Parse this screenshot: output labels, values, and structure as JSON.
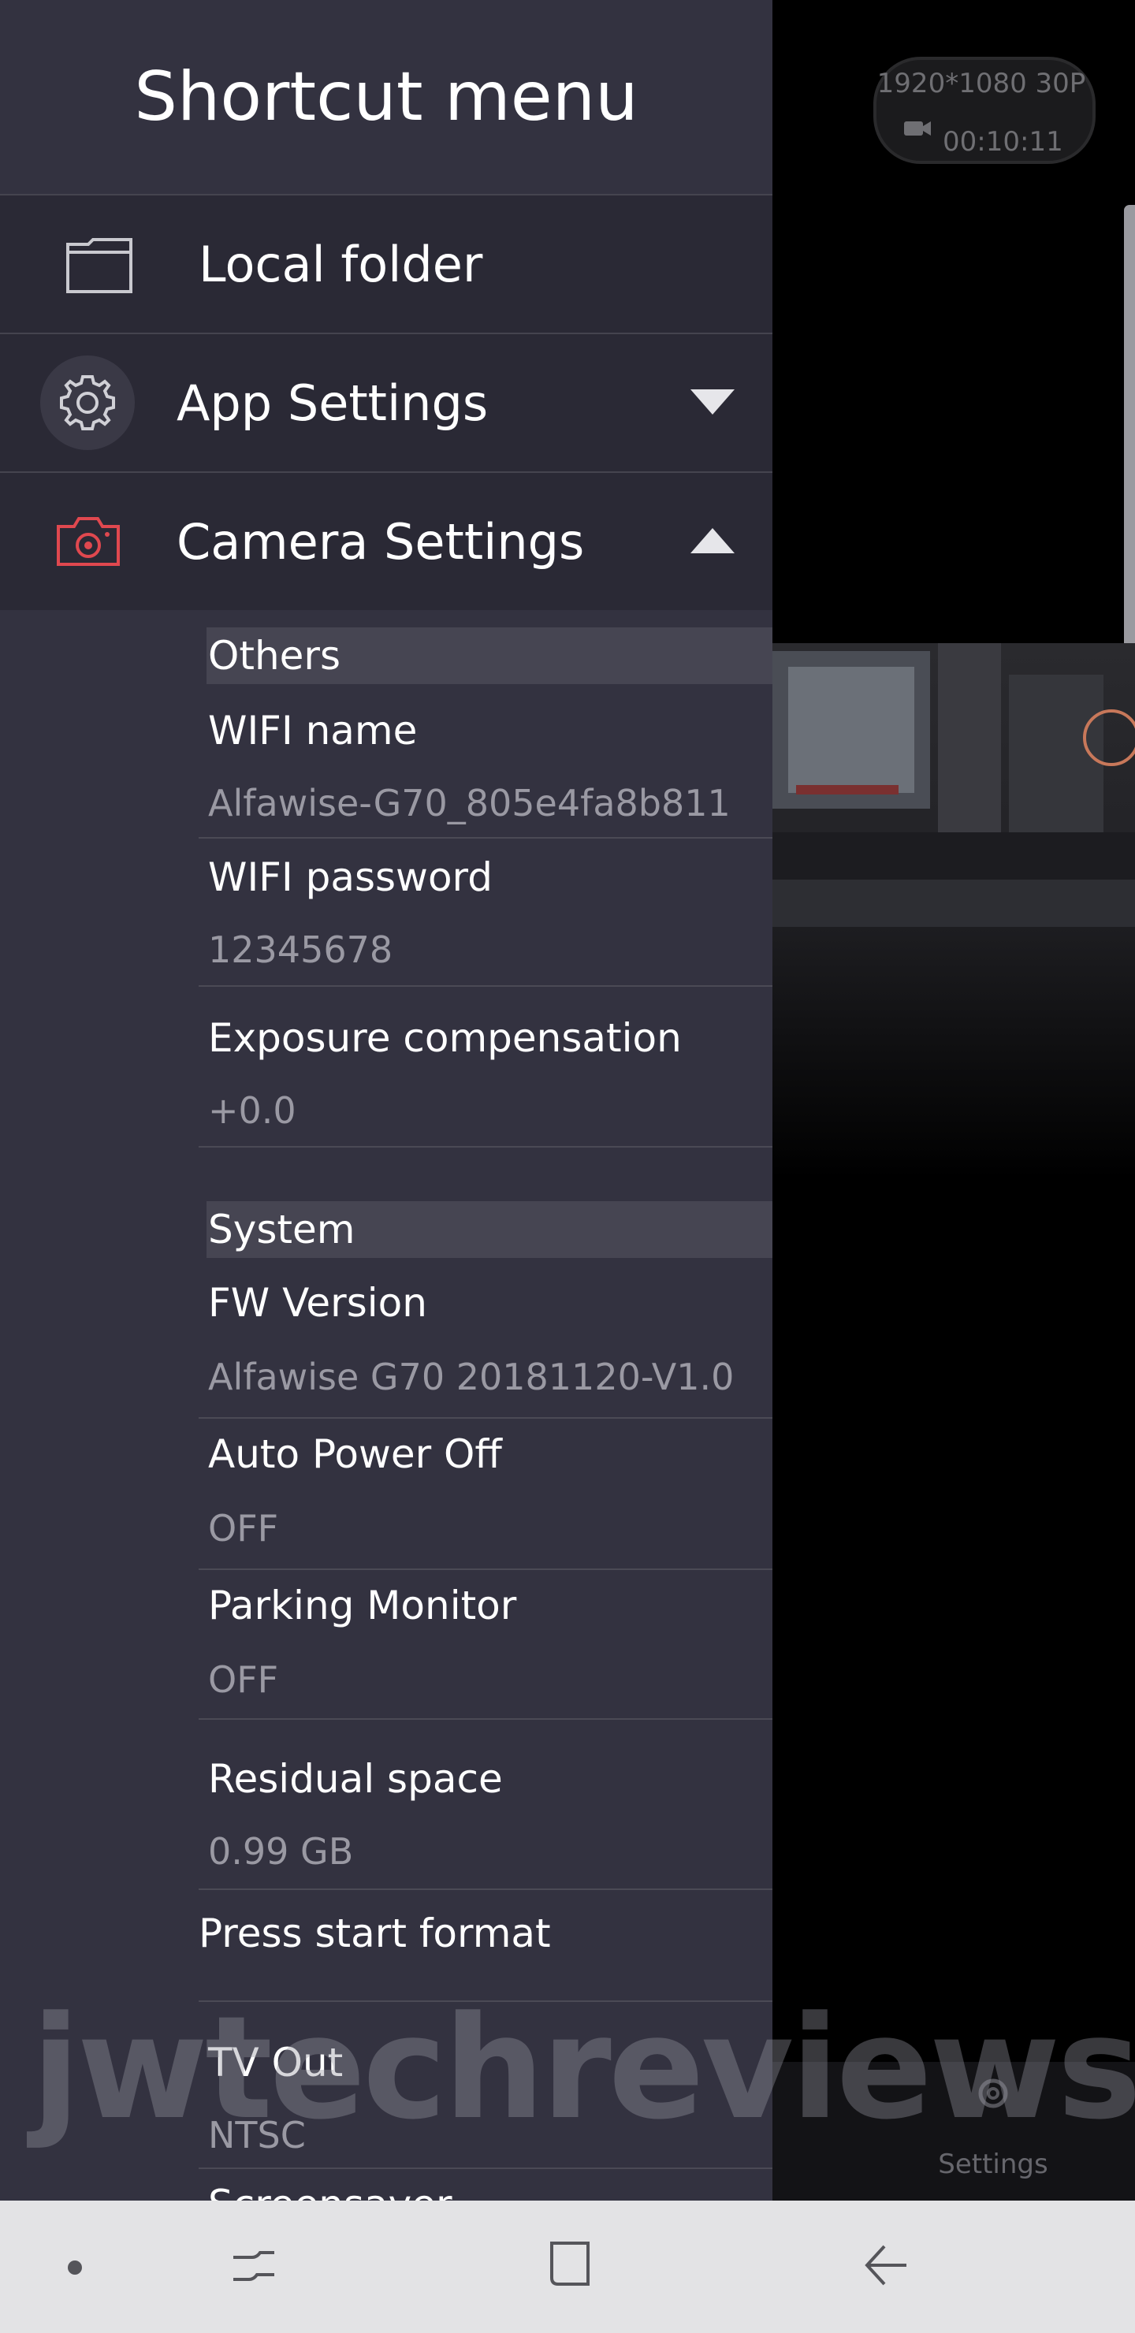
{
  "preview": {
    "resolution": "1920*1080 30P",
    "rec_time": "00:10:11",
    "settings_tab_label": "Settings"
  },
  "drawer": {
    "title": "Shortcut menu",
    "menu": [
      {
        "label": "Local folder",
        "icon": "folder-icon"
      },
      {
        "label": "App Settings",
        "icon": "gear-icon",
        "expanded": false
      },
      {
        "label": "Camera Settings",
        "icon": "camera-icon",
        "expanded": true
      }
    ],
    "sections": {
      "others": "Others",
      "system": "System"
    },
    "items": {
      "wifi_name": {
        "title": "WIFI name",
        "value": "Alfawise-G70_805e4fa8b811"
      },
      "wifi_password": {
        "title": "WIFI password",
        "value": "12345678"
      },
      "exposure": {
        "title": "Exposure compensation",
        "value": "+0.0"
      },
      "fw_version": {
        "title": "FW Version",
        "value": "Alfawise G70 20181120-V1.0"
      },
      "auto_power_off": {
        "title": "Auto Power Off",
        "value": "OFF"
      },
      "parking_monitor": {
        "title": "Parking Monitor",
        "value": "OFF"
      },
      "residual_space": {
        "title": "Residual space",
        "value": "0.99 GB"
      },
      "press_start_format": {
        "title": "Press start format"
      },
      "tv_out": {
        "title": "TV Out",
        "value": "NTSC"
      },
      "next_partial": {
        "title": "Screensaver"
      }
    }
  },
  "watermark": "jwtechreviews.com",
  "colors": {
    "drawer_bg": "#333240",
    "menu_row_bg": "#2a2935",
    "section_bg": "#464552",
    "accent_red": "#e0484f"
  }
}
